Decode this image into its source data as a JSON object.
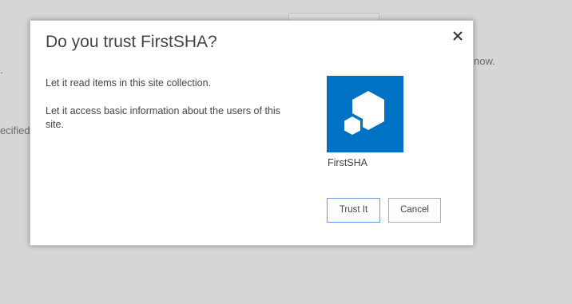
{
  "background": {
    "fragment_left_top": ".",
    "fragment_left": "ecified",
    "fragment_right": "now."
  },
  "dialog": {
    "title": "Do you trust FirstSHA?",
    "close_icon": "close-icon",
    "permissions": [
      "Let it read items in this site collection.",
      "Let it access basic information about the users of this site."
    ],
    "app": {
      "name": "FirstSHA",
      "logo_icon": "app-cube-icon",
      "logo_color": "#0072c6"
    },
    "buttons": {
      "trust_label": "Trust It",
      "cancel_label": "Cancel"
    }
  },
  "colors": {
    "overlay": "#d6d6d6",
    "accent": "#0072c6",
    "primary_button_border": "#6a9bd8"
  }
}
